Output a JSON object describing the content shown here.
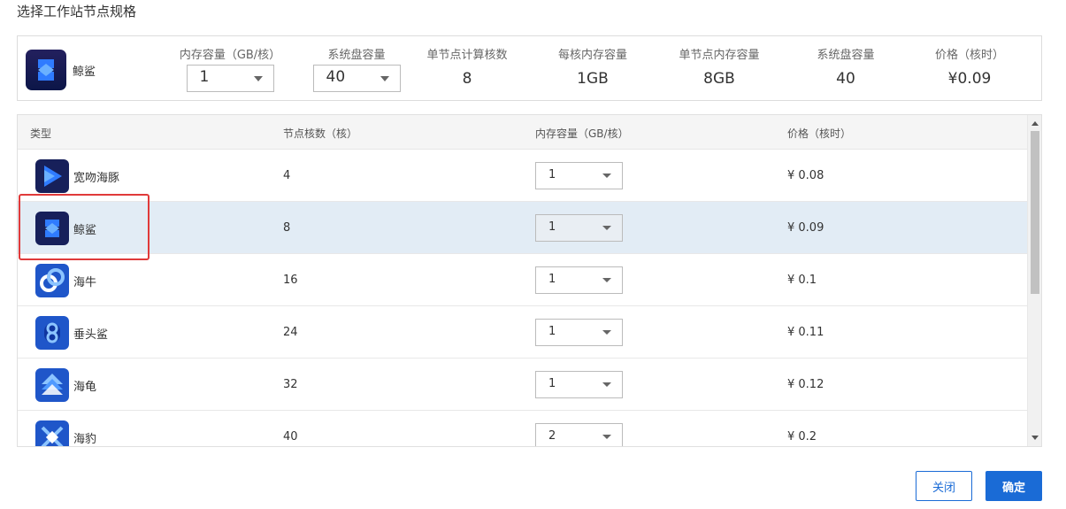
{
  "dialog": {
    "title": "选择工作站节点规格"
  },
  "summary": {
    "name": "鲸鲨",
    "icon": "whale-shark-icon",
    "memory": {
      "label": "内存容量（GB/核）",
      "value": "1"
    },
    "disk_select": {
      "label": "系统盘容量",
      "value": "40"
    },
    "cores": {
      "label": "单节点计算核数",
      "value": "8"
    },
    "mem_per_core": {
      "label": "每核内存容量",
      "value": "1GB"
    },
    "node_mem": {
      "label": "单节点内存容量",
      "value": "8GB"
    },
    "disk": {
      "label": "系统盘容量",
      "value": "40"
    },
    "price": {
      "label": "价格（核时）",
      "value": "¥0.09"
    }
  },
  "table": {
    "headers": [
      "类型",
      "节点核数（核）",
      "内存容量（GB/核）",
      "价格（核时）"
    ],
    "rows": [
      {
        "name": "宽吻海豚",
        "icon": "dolphin-icon",
        "cores": "4",
        "memory": "1",
        "price": "¥ 0.08"
      },
      {
        "name": "鲸鲨",
        "icon": "whale-shark-icon",
        "cores": "8",
        "memory": "1",
        "price": "¥ 0.09",
        "selected": true
      },
      {
        "name": "海牛",
        "icon": "manatee-icon",
        "cores": "16",
        "memory": "1",
        "price": "¥ 0.1"
      },
      {
        "name": "垂头鲨",
        "icon": "hammerhead-icon",
        "cores": "24",
        "memory": "1",
        "price": "¥ 0.11"
      },
      {
        "name": "海龟",
        "icon": "sea-turtle-icon",
        "cores": "32",
        "memory": "1",
        "price": "¥ 0.12"
      },
      {
        "name": "海豹",
        "icon": "seal-icon",
        "cores": "40",
        "memory": "2",
        "price": "¥ 0.2"
      }
    ]
  },
  "buttons": {
    "close": "关闭",
    "ok": "确定"
  },
  "colors": {
    "accent": "#1a6bd6",
    "selected_row": "#e2ecf5",
    "highlight": "#e03a3a"
  }
}
